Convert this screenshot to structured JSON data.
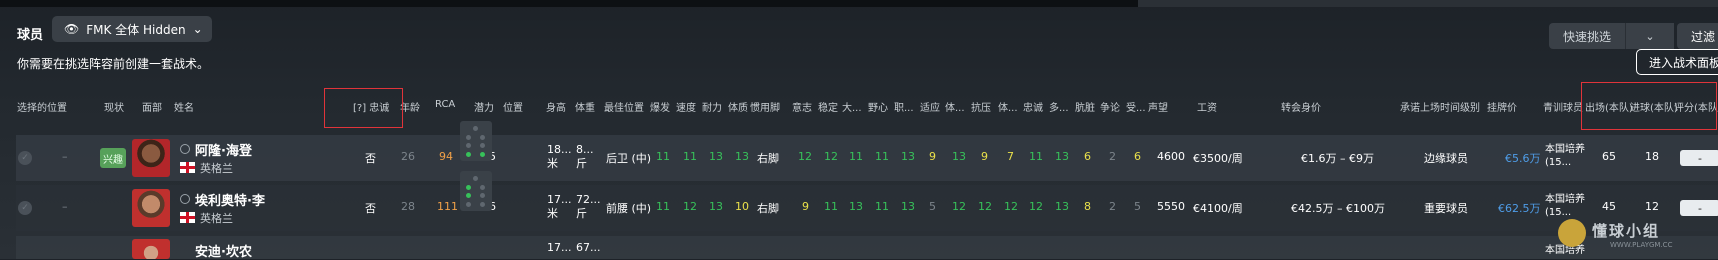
{
  "header": {
    "title": "球员",
    "view_label": "FMK 全体 Hidden",
    "quick_pick": "快速挑选",
    "filter": "过滤",
    "tactic_button": "进入战术面板",
    "message": "你需要在挑选阵容前创建一套战术。"
  },
  "columns": {
    "selected_position": "选择的位置",
    "status": "现状",
    "face": "面部",
    "name": "姓名",
    "hidden_col": "[?] 忠诚",
    "age": "年龄",
    "rca": "RCA",
    "potential": "潜力",
    "position": "位置",
    "height": "身高",
    "weight": "体重",
    "best_position": "最佳位置",
    "explosive": "爆发",
    "speed": "速度",
    "stamina": "耐力",
    "strength": "体质",
    "foot": "惯用脚",
    "will": "意志",
    "stability": "稳定",
    "big_match": "大...",
    "ambition": "野心",
    "professional": "职...",
    "adapt": "适应",
    "sports": "体...",
    "pressure": "抗压",
    "sports2": "体...",
    "loyalty": "忠诚",
    "multi": "多...",
    "dirty": "肮脏",
    "controversy": "争论",
    "injury": "受...",
    "reputation": "声望",
    "wage": "工资",
    "transfer_value": "转会身价",
    "squad_status": "承诺上场时间级别",
    "asking_price": "挂牌价",
    "youth": "青训球员",
    "apps": "出场(本队)",
    "goals": "进球(本队)",
    "rating": "评分(本队)"
  },
  "players": [
    {
      "status_tag": "兴趣",
      "name": "阿隆·海登",
      "nation": "英格兰",
      "hidden": "否",
      "age": "26",
      "rca": "94",
      "potential": "115",
      "height": "18...米",
      "weight": "8...斤",
      "best_position": "后卫 (中)",
      "attrs": [
        "11",
        "11",
        "13",
        "13"
      ],
      "foot": "右脚",
      "attrs2": [
        "12",
        "12",
        "11",
        "11",
        "13",
        "9",
        "13",
        "9",
        "7",
        "11",
        "13",
        "6",
        "2",
        "6"
      ],
      "reputation": "4600",
      "wage": "€3500/周",
      "transfer_value": "€1.6万 – €9万",
      "squad_status": "边缘球员",
      "asking_price": "€5.6万",
      "youth": "本国培养(15...",
      "apps": "65",
      "goals": "18",
      "rating": "-"
    },
    {
      "status_tag": "",
      "name": "埃利奥特·李",
      "nation": "英格兰",
      "hidden": "否",
      "age": "28",
      "rca": "111",
      "potential": "116",
      "height": "17...米",
      "weight": "72...斤",
      "best_position": "前腰 (中)",
      "attrs": [
        "11",
        "12",
        "13",
        "10"
      ],
      "foot": "右脚",
      "attrs2": [
        "9",
        "11",
        "13",
        "11",
        "13",
        "5",
        "12",
        "12",
        "12",
        "12",
        "13",
        "8",
        "2",
        "5"
      ],
      "reputation": "5550",
      "wage": "€4100/周",
      "transfer_value": "€42.5万 – €100万",
      "squad_status": "重要球员",
      "asking_price": "€62.5万",
      "youth": "本国培养(15...",
      "apps": "45",
      "goals": "12",
      "rating": "-"
    },
    {
      "status_tag": "",
      "name": "安迪·坎农",
      "nation": "",
      "hidden": "",
      "height": "17...",
      "weight": "67...",
      "youth": "本国培养"
    }
  ],
  "watermark": {
    "text": "懂球小组",
    "url": "WWW.PLAYGM.CC"
  },
  "colors": {
    "green": "#37c15a",
    "yellow": "#e9e04a",
    "orange": "#f0a048",
    "blue": "#4f9de8",
    "red_box": "#e0343a"
  }
}
